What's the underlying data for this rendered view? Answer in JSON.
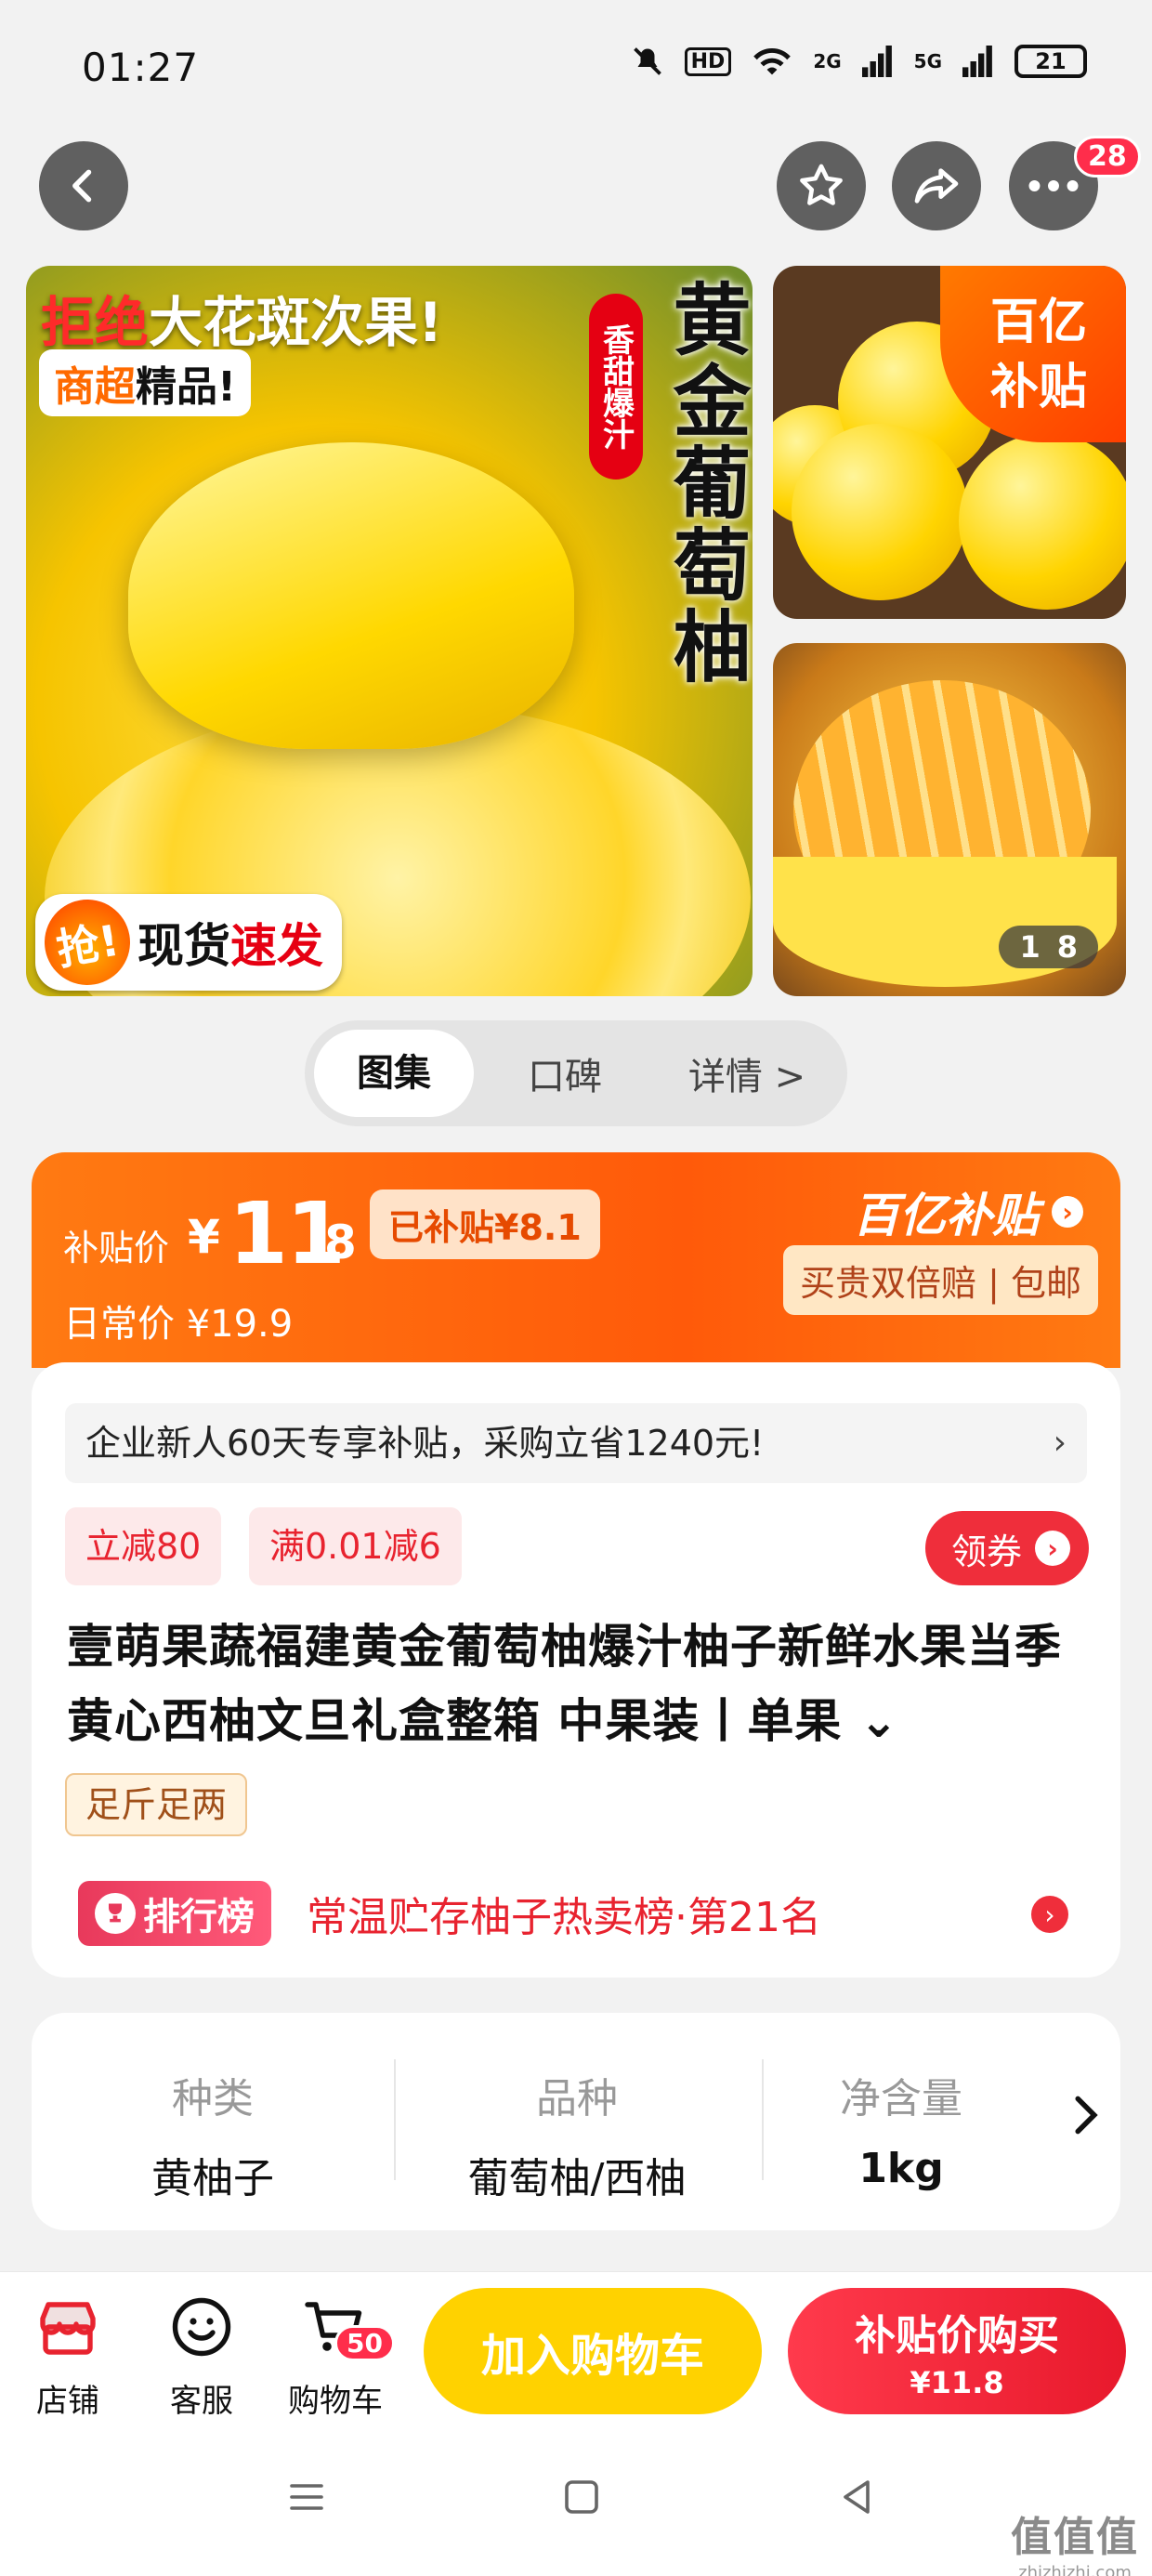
{
  "status_bar": {
    "time": "01:27",
    "hd": "HD",
    "net2g": "2G",
    "net5g": "5G",
    "battery": "21"
  },
  "nav": {
    "back": "‹",
    "badge_count": "28"
  },
  "gallery": {
    "main_banner_red": "拒绝",
    "main_banner_rest": "大花斑次果!",
    "main_pill_orange": "商超",
    "main_pill_rest": "精品!",
    "vertical_tag": "香甜爆汁",
    "vertical_title": "黄金葡萄柚",
    "grab_icon": "抢!",
    "grab_text": "现货",
    "grab_red": "速发",
    "subsidy_corner": "百亿\n补贴",
    "pager_current": "1",
    "pager_total": "8"
  },
  "tabs": [
    {
      "label": "图集",
      "active": true
    },
    {
      "label": "口碑",
      "active": false
    },
    {
      "label": "详情 >",
      "active": false
    }
  ],
  "price": {
    "label": "补贴价",
    "yen": "¥",
    "int": "11",
    "dec": ".8",
    "subsidized": "已补贴¥8.1",
    "daily": "日常价 ¥19.9",
    "brand": "百亿补贴",
    "brand_arrow": "›",
    "guarantee": "买贵双倍赔 | 包邮"
  },
  "info": {
    "promo": "企业新人60天专享补贴，采购立省1240元!",
    "promo_chevron": "›",
    "tag1": "立减80",
    "tag2": "满0.01减6",
    "coupon": "领券",
    "coupon_arrow": "›",
    "title": "壹萌果蔬福建黄金葡萄柚爆汁柚子新鲜水果当季黄心西柚文旦礼盒整箱 中果装丨单果 ⌄",
    "weight_tag": "足斤足两",
    "rank_badge": "排行榜",
    "rank_text": "常温贮存柚子热卖榜·第21名",
    "rank_arrow": "›"
  },
  "attributes": [
    {
      "key": "种类",
      "value": "黄柚子"
    },
    {
      "key": "品种",
      "value": "葡萄柚/西柚"
    },
    {
      "key": "净含量",
      "value": "1kg"
    }
  ],
  "bottom_bar": {
    "store": "店铺",
    "service": "客服",
    "cart": "购物车",
    "cart_count": "50",
    "add_cart": "加入购物车",
    "buy_main": "补贴价购买",
    "buy_price": "¥11.8"
  },
  "watermark": {
    "big": "值值值",
    "small": "zhizhizhi.com"
  },
  "colors": {
    "accent": "#ff5a0a",
    "red": "#ef2e3b",
    "yellow": "#ffd200"
  }
}
